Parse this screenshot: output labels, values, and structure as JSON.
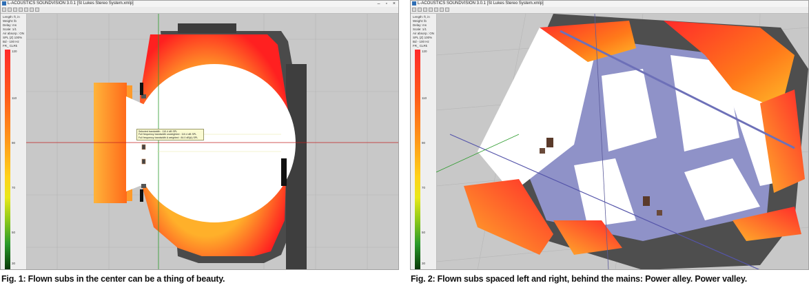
{
  "fig1": {
    "window_title": "L-ACOUSTICS SOUNDVISION 3.0.1 [St Lukes Stereo System.xmlp]",
    "info_lines": [
      "Length: ft, in",
      "Weight: lb",
      "Delay: ms",
      "Scale: 1/1",
      "Air absorp.: ON",
      "SPL (Z) 100%",
      "Bd - 100 Hz",
      "FR_ CLRk"
    ],
    "scale_top": "120",
    "scale_ticks": [
      "110",
      "90",
      "70",
      "50",
      "30"
    ],
    "scale_bottom": "87",
    "tooltip_lines": [
      "Selected bandwidth : 110.4 dB SPL",
      "Full frequency bandwidth unweighted : 110.4 dB SPL",
      "Full frequency bandwidth A weighted : 84.0 dB(A) SPL"
    ],
    "caption": "Fig. 1: Flown subs in the center can be a thing of beauty."
  },
  "fig2": {
    "window_title": "L-ACOUSTICS SOUNDVISION 3.0.1 [St Lukes Stereo System.xmlp]",
    "info_lines": [
      "Length: ft, in",
      "Weight: lb",
      "Delay: ms",
      "Scale: 1/1",
      "Air absorp.: ON",
      "SPL (Z) 100%",
      "Bd - 100 Hz",
      "FR_ CLRk"
    ],
    "scale_top": "120",
    "scale_ticks": [
      "110",
      "90",
      "70",
      "50",
      "30"
    ],
    "scale_bottom": "87",
    "caption": "Fig. 2: Flown subs spaced left and right, behind the mains: Power alley. Power valley."
  },
  "window_controls": [
    "–",
    "▫",
    "×"
  ],
  "colors": {
    "spl_hot": "#ff2a2a",
    "spl_warm": "#ffa01a",
    "white_zone": "#ffffff",
    "surface": "#4a4a4a",
    "blue_zone": "#8f92c8"
  }
}
